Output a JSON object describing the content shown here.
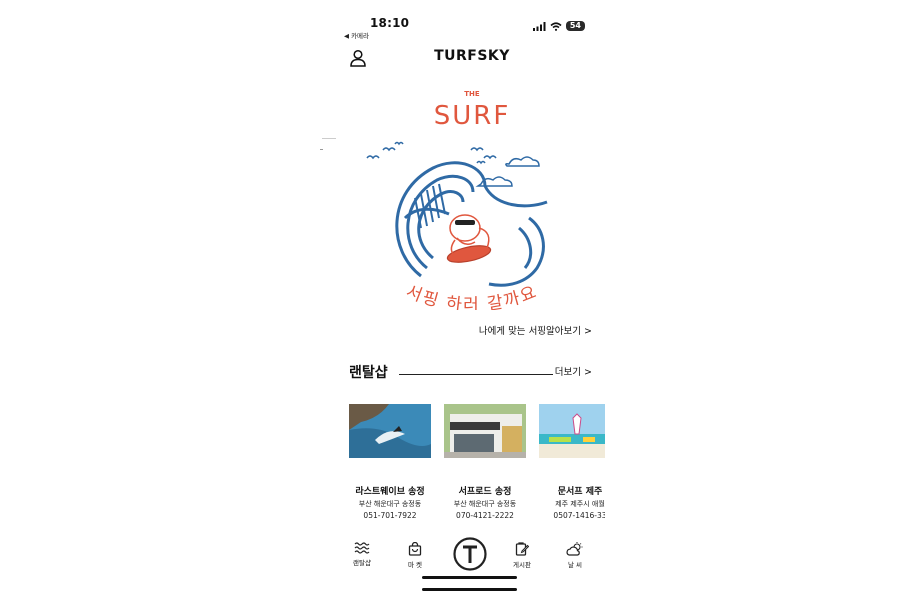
{
  "status": {
    "time": "18:10",
    "back": "◀ 카메라",
    "battery": "54"
  },
  "header": {
    "brand": "TURFSKY"
  },
  "hero": {
    "the": "THE",
    "surf": "SURF",
    "arc_text": "서핑 하러 갈까요"
  },
  "quiz_link": "나에게 맞는 서핑알아보기 >",
  "section": {
    "title": "랜탈샵",
    "more": "더보기 >"
  },
  "shops": [
    {
      "name": "라스트웨이브 송정",
      "address": "부산 해운대구 송정동",
      "phone": "051-701-7922"
    },
    {
      "name": "서프로드 송정",
      "address": "부산 해운대구 송정동",
      "phone": "070-4121-2222"
    },
    {
      "name": "문서프 제주",
      "address": "제주 제주시 애월",
      "phone": "0507-1416-33"
    }
  ],
  "nav": [
    {
      "label": "랜탈샵",
      "icon": "waves-icon"
    },
    {
      "label": "마 켓",
      "icon": "shopping-bag-icon"
    },
    {
      "label": "",
      "icon": "home-t-icon"
    },
    {
      "label": "게시판",
      "icon": "edit-board-icon"
    },
    {
      "label": "날 씨",
      "icon": "weather-icon"
    }
  ],
  "colors": {
    "accent": "#e0573e",
    "wave_blue": "#2f6aa5"
  }
}
